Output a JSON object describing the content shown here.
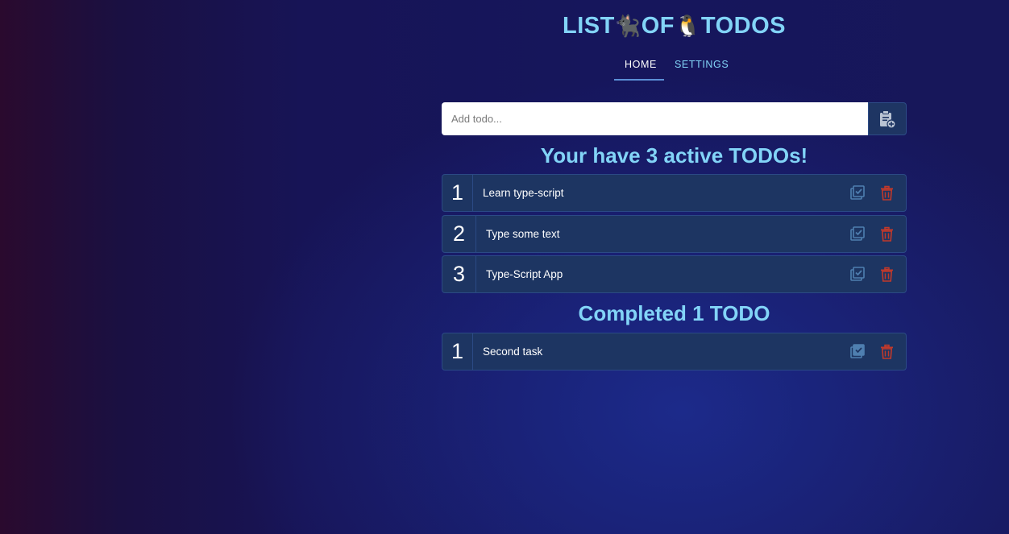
{
  "header": {
    "title_part1": "LIST",
    "title_emoji1": "🐈‍⬛",
    "title_part2": "OF",
    "title_emoji2": "🐧",
    "title_part3": "TODOS"
  },
  "nav": {
    "tabs": [
      {
        "label": "HOME",
        "active": true
      },
      {
        "label": "SETTINGS",
        "active": false
      }
    ]
  },
  "add_todo": {
    "placeholder": "Add todo...",
    "value": "",
    "button_icon": "clipboard-plus-icon"
  },
  "active_section": {
    "heading": "Your have 3 active TODOs!",
    "items": [
      {
        "number": "1",
        "text": "Learn type-script"
      },
      {
        "number": "2",
        "text": "Type some text"
      },
      {
        "number": "3",
        "text": "Type-Script App"
      }
    ]
  },
  "completed_section": {
    "heading": "Completed 1 TODO",
    "items": [
      {
        "number": "1",
        "text": "Second task"
      }
    ]
  },
  "icons": {
    "complete": "checkbox-multiple-icon",
    "delete": "trash-icon"
  },
  "colors": {
    "accent": "#82d4f7",
    "item_bg": "#1d3562",
    "delete": "#c0392b",
    "complete_icon": "#4f7fb0"
  }
}
